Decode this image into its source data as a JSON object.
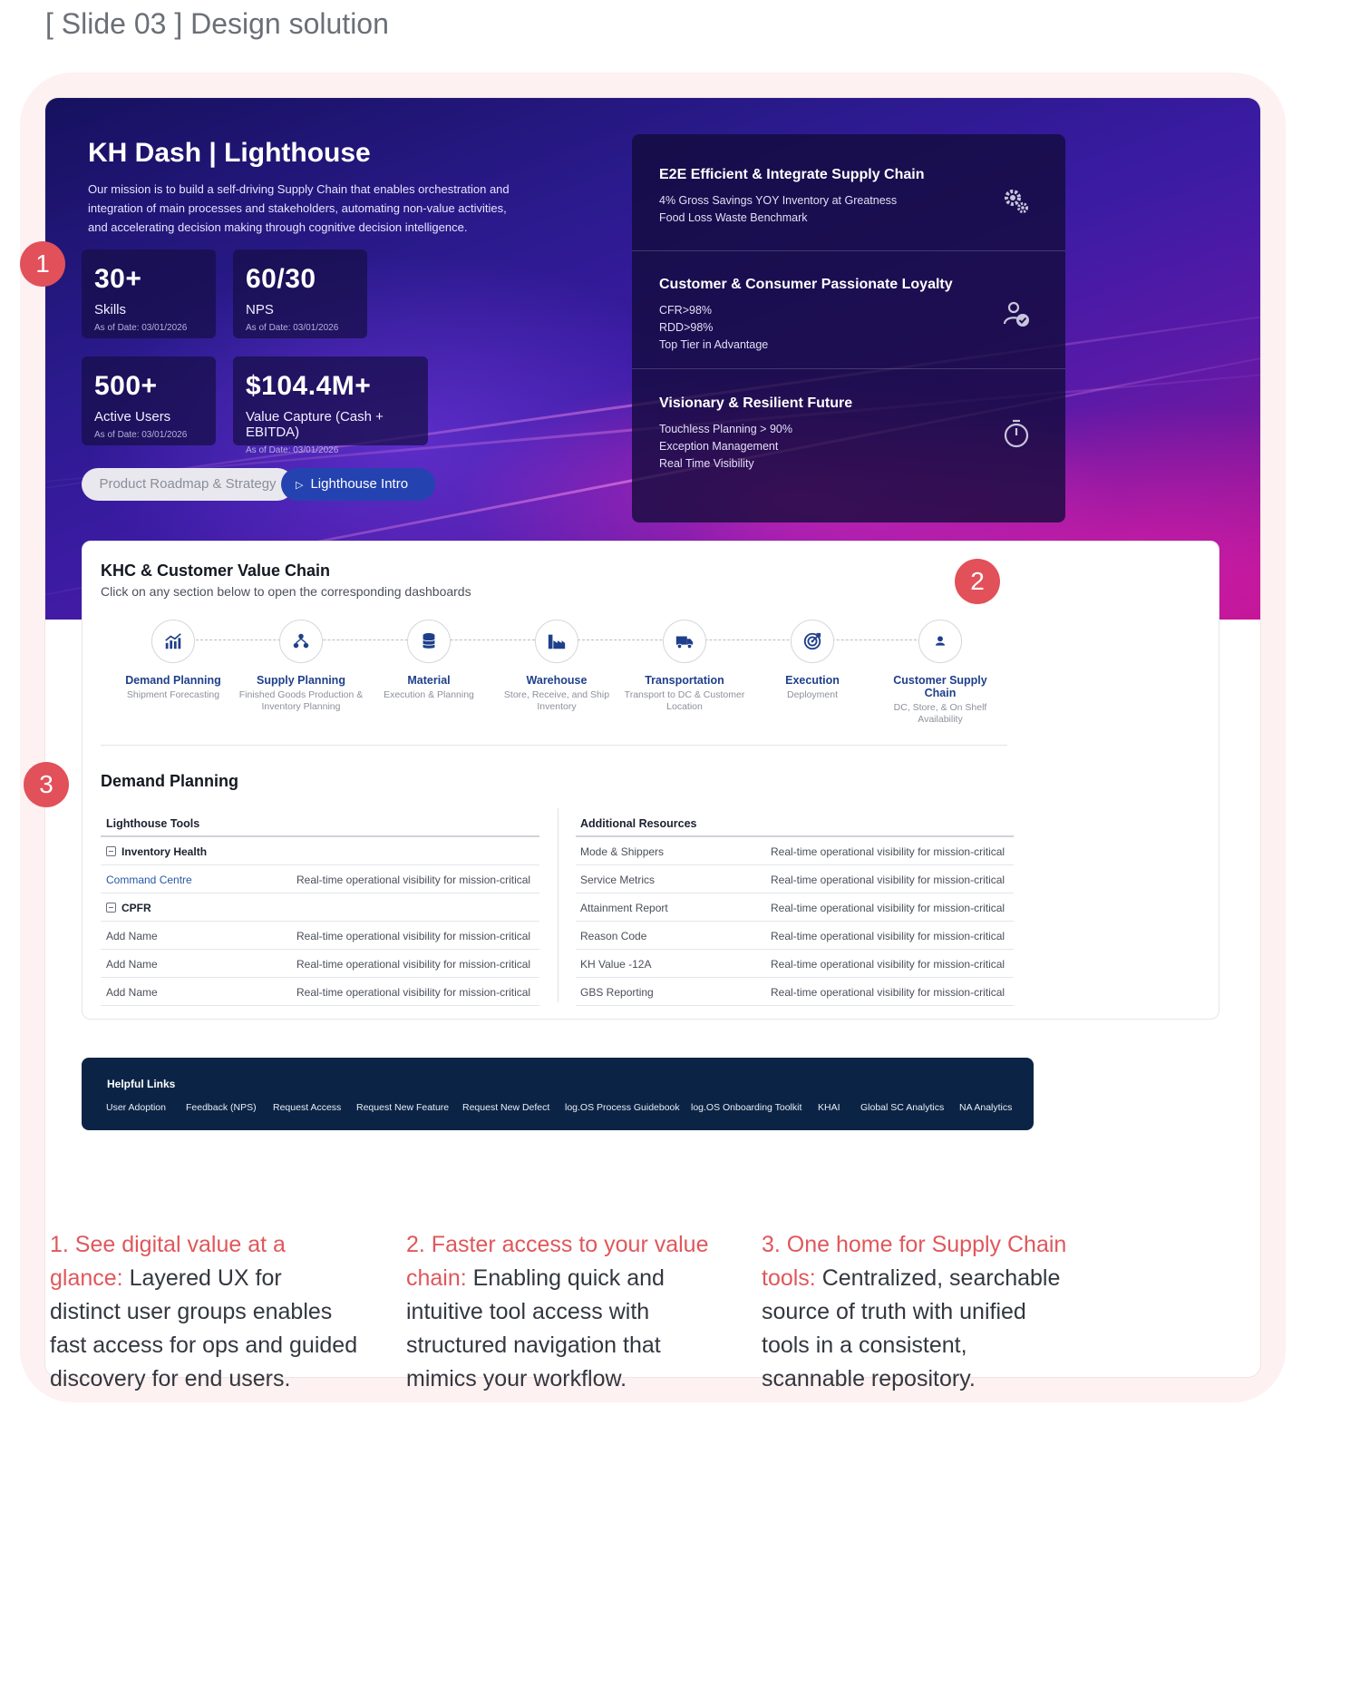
{
  "slide_label": "[ Slide 03 ] Design solution",
  "hero": {
    "title": "KH Dash | Lighthouse",
    "mission": "Our mission is to build a self-driving Supply Chain that enables orchestration and integration of main processes and stakeholders, automating non-value activities, and accelerating decision making through cognitive decision intelligence.",
    "stats": [
      {
        "value": "30+",
        "label": "Skills",
        "date": "As of Date: 03/01/2026"
      },
      {
        "value": "60/30",
        "label": "NPS",
        "date": "As of Date: 03/01/2026"
      },
      {
        "value": "500+",
        "label": "Active Users",
        "date": "As of Date: 03/01/2026"
      },
      {
        "value": "$104.4M+",
        "label": "Value Capture (Cash + EBITDA)",
        "date": "As of Date: 03/01/2026"
      }
    ],
    "buttons": {
      "roadmap": "Product Roadmap & Strategy",
      "intro": "Lighthouse Intro"
    },
    "pillars": [
      {
        "title": "E2E Efficient & Integrate Supply Chain",
        "lines": [
          "4% Gross Savings YOY Inventory at Greatness",
          "Food Loss Waste Benchmark"
        ],
        "icon": "gears-icon"
      },
      {
        "title": "Customer & Consumer Passionate Loyalty",
        "lines": [
          "CFR>98%",
          "RDD>98%",
          "Top Tier in Advantage"
        ],
        "icon": "user-check-icon"
      },
      {
        "title": "Visionary & Resilient Future",
        "lines": [
          "Touchless Planning > 90%",
          "Exception Management",
          "Real Time Visibility"
        ],
        "icon": "stopwatch-icon"
      }
    ]
  },
  "value_chain": {
    "title": "KHC & Customer Value Chain",
    "subtitle": "Click on any section below to open the corresponding dashboards",
    "steps": [
      {
        "name": "Demand Planning",
        "desc": "Shipment Forecasting",
        "icon": "chart-icon"
      },
      {
        "name": "Supply Planning",
        "desc": "Finished Goods Production & Inventory Planning",
        "icon": "network-icon"
      },
      {
        "name": "Material",
        "desc": "Execution & Planning",
        "icon": "database-icon"
      },
      {
        "name": "Warehouse",
        "desc": "Store, Receive, and Ship Inventory",
        "icon": "warehouse-icon"
      },
      {
        "name": "Transportation",
        "desc": "Transport to DC & Customer Location",
        "icon": "truck-icon"
      },
      {
        "name": "Execution",
        "desc": "Deployment",
        "icon": "target-icon"
      },
      {
        "name": "Customer Supply Chain",
        "desc": "DC, Store, & On Shelf Availability",
        "icon": "person-icon"
      }
    ]
  },
  "demand_planning": {
    "title": "Demand Planning",
    "tools": {
      "header": "Lighthouse Tools",
      "groups": [
        {
          "name": "Inventory Health",
          "rows": [
            {
              "name": "Command Centre",
              "desc": "Real-time operational visibility for mission-critical"
            }
          ]
        },
        {
          "name": "CPFR",
          "rows": [
            {
              "name": "Add Name",
              "desc": "Real-time operational visibility for mission-critical"
            },
            {
              "name": "Add Name",
              "desc": "Real-time operational visibility for mission-critical"
            },
            {
              "name": "Add Name",
              "desc": "Real-time operational visibility for mission-critical"
            }
          ]
        }
      ]
    },
    "resources": {
      "header": "Additional Resources",
      "rows": [
        {
          "name": "Mode & Shippers",
          "desc": "Real-time operational visibility for mission-critical"
        },
        {
          "name": "Service Metrics",
          "desc": "Real-time operational visibility for mission-critical"
        },
        {
          "name": "Attainment Report",
          "desc": "Real-time operational visibility for mission-critical"
        },
        {
          "name": "Reason Code",
          "desc": "Real-time operational visibility for mission-critical"
        },
        {
          "name": "KH Value -12A",
          "desc": "Real-time operational visibility for mission-critical"
        },
        {
          "name": "GBS Reporting",
          "desc": "Real-time operational visibility for mission-critical"
        }
      ]
    }
  },
  "helpful_links": {
    "title": "Helpful Links",
    "links": [
      "User Adoption",
      "Feedback (NPS)",
      "Request Access",
      "Request New Feature",
      "Request New Defect",
      "log.OS Process Guidebook",
      "log.OS Onboarding Toolkit",
      "KHAI",
      "Global SC Analytics",
      "NA Analytics"
    ]
  },
  "badges": [
    "1",
    "2",
    "3"
  ],
  "captions": [
    {
      "highlight": "1. See digital value at a glance:",
      "text": " Layered UX for distinct user groups enables fast access for ops and guided discovery for end users."
    },
    {
      "highlight": "2. Faster access to your value chain:",
      "text": " Enabling quick and intuitive tool access with structured navigation that mimics your workflow."
    },
    {
      "highlight": "3. One home for Supply Chain tools:",
      "text": " Centralized, searchable source of truth with unified tools in a consistent, scannable repository."
    }
  ],
  "colors": {
    "accent_red": "#e0575b",
    "hero_dark": "#16115e",
    "hero_magenta": "#b0108a",
    "link_blue": "#1f3f8a",
    "footer_navy": "#0b2445"
  }
}
